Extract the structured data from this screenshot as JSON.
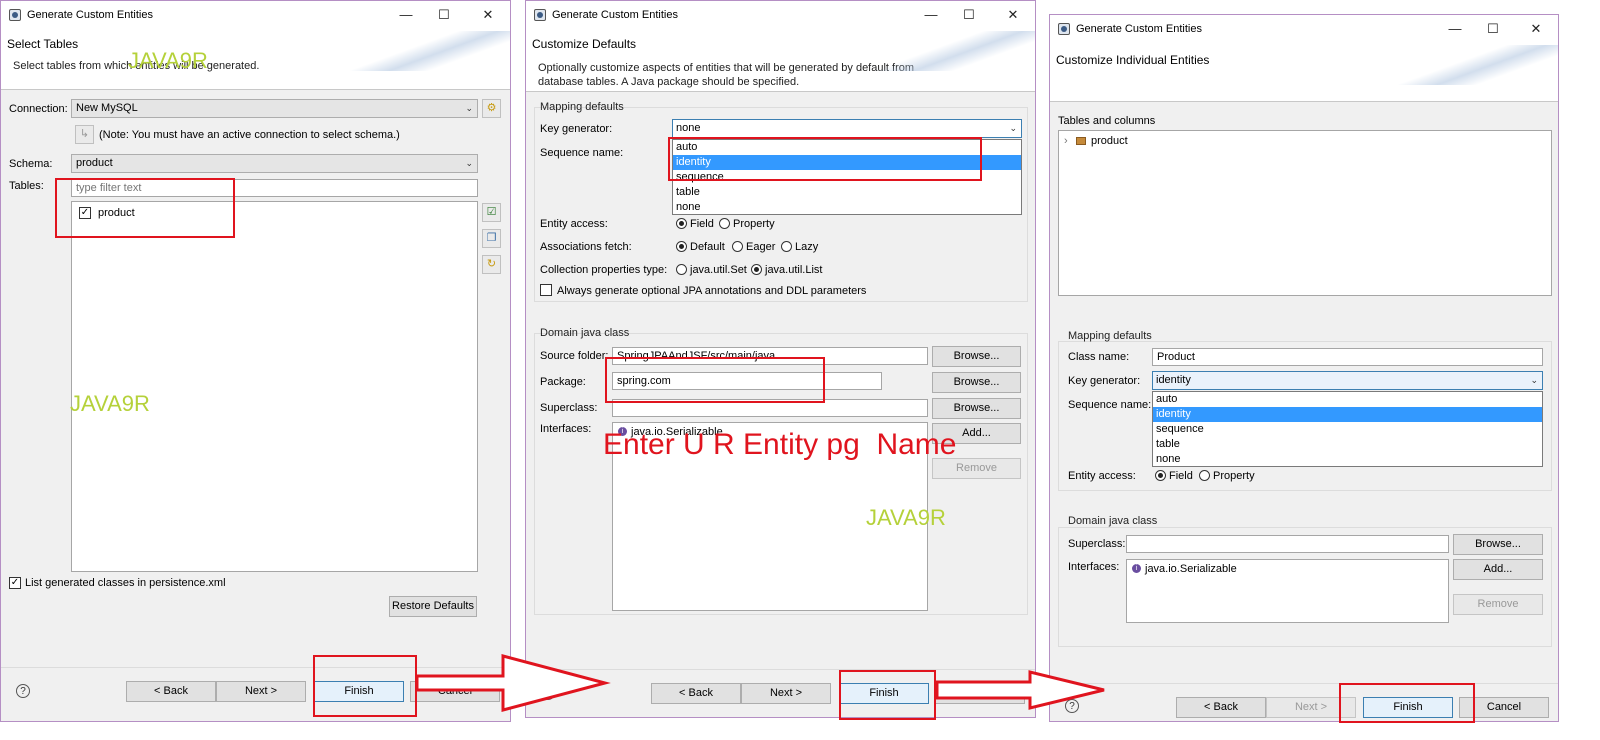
{
  "windows": [
    {
      "title": "Generate Custom Entities",
      "header_title": "Select Tables",
      "header_desc": "Select tables from which entities will be generated.",
      "connection_label": "Connection:",
      "connection_value": "New MySQL",
      "connect_note": "(Note: You must have an active connection to select schema.)",
      "schema_label": "Schema:",
      "schema_value": "product",
      "tables_label": "Tables:",
      "filter_placeholder": "type filter text",
      "table_item": "product",
      "list_generated": "List generated classes in persistence.xml",
      "restore_defaults": "Restore Defaults",
      "back": "< Back",
      "next": "Next >",
      "finish": "Finish",
      "cancel": "Cancel"
    },
    {
      "title": "Generate Custom Entities",
      "header_title": "Customize Defaults",
      "header_desc_1": "Optionally customize aspects of entities that will be generated by default from",
      "header_desc_2": "database tables. A Java package should be specified.",
      "mapping_group": "Mapping defaults",
      "key_generator_label": "Key generator:",
      "key_generator_value": "none",
      "sequence_name_label": "Sequence name:",
      "key_options": [
        "auto",
        "identity",
        "sequence",
        "table",
        "none"
      ],
      "entity_access_label": "Entity access:",
      "field": "Field",
      "property": "Property",
      "assoc_fetch_label": "Associations fetch:",
      "default": "Default",
      "eager": "Eager",
      "lazy": "Lazy",
      "collection_label": "Collection properties type:",
      "java_set": "java.util.Set",
      "java_list": "java.util.List",
      "always_generate": "Always generate optional JPA annotations and DDL parameters",
      "domain_group": "Domain java class",
      "source_folder_label": "Source folder:",
      "source_folder_value": "SpringJPAAndJSF/src/main/java",
      "package_label": "Package:",
      "package_value": "spring.com",
      "superclass_label": "Superclass:",
      "interfaces_label": "Interfaces:",
      "interface_item": "java.io.Serializable",
      "browse": "Browse...",
      "add": "Add...",
      "remove": "Remove",
      "back": "< Back",
      "next": "Next >",
      "finish": "Finish",
      "cancel": "Cancel"
    },
    {
      "title": "Generate Custom Entities",
      "header_title": "Customize Individual Entities",
      "tables_columns_label": "Tables and columns",
      "tree_item": "product",
      "mapping_group": "Mapping defaults",
      "class_name_label": "Class name:",
      "class_name_value": "Product",
      "key_generator_label": "Key generator:",
      "key_generator_value": "identity",
      "sequence_name_label": "Sequence name:",
      "key_options": [
        "auto",
        "identity",
        "sequence",
        "table",
        "none"
      ],
      "entity_access_label": "Entity access:",
      "field": "Field",
      "property": "Property",
      "domain_group": "Domain java class",
      "superclass_label": "Superclass:",
      "interfaces_label": "Interfaces:",
      "interface_item": "java.io.Serializable",
      "browse": "Browse...",
      "add": "Add...",
      "remove": "Remove",
      "back": "< Back",
      "next": "Next >",
      "finish": "Finish",
      "cancel": "Cancel"
    }
  ],
  "annotations": {
    "watermark": "JAVA9R",
    "entity_note": "Enter U R Entity pg  Name"
  },
  "colors": {
    "highlight_box": "#e0141e",
    "watermark": "#b5d13a",
    "selection": "#3399ff"
  }
}
